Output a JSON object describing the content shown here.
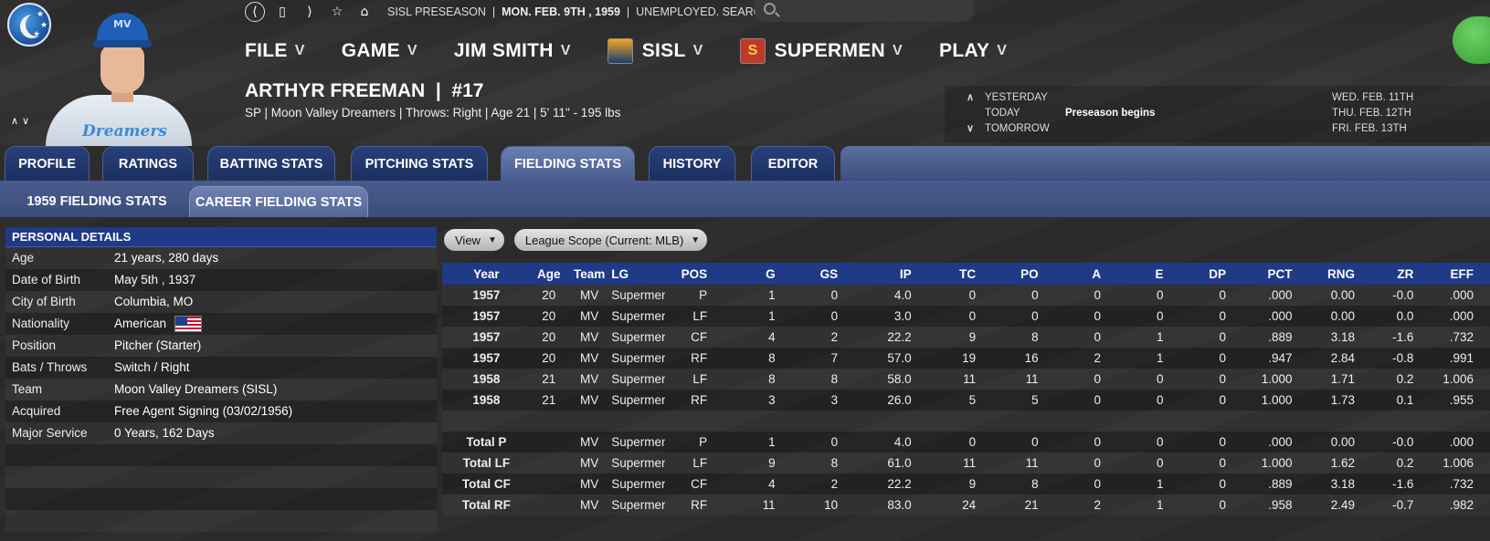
{
  "status_bar": {
    "season": "SISL PRESEASON",
    "date": "MON. FEB. 9TH , 1959",
    "job": "UNEMPLOYED. SEARCH JOBS..."
  },
  "search": {
    "placeholder": ""
  },
  "menu": [
    {
      "label": "FILE",
      "icon": null
    },
    {
      "label": "GAME",
      "icon": null
    },
    {
      "label": "JIM SMITH",
      "icon": null
    },
    {
      "label": "SISL",
      "icon": "sisl-league-logo"
    },
    {
      "label": "SUPERMEN",
      "icon": "supermen-team-logo"
    },
    {
      "label": "PLAY",
      "icon": null
    }
  ],
  "player": {
    "name": "ARTHYR FREEMAN",
    "number": "#17",
    "subtitle": "SP | Moon Valley Dreamers  |  Throws: Right  |  Age 21  |  5' 11\" - 195 lbs",
    "jersey_text": "Dreamers",
    "cap_text": "MV"
  },
  "calendar": {
    "rows": [
      {
        "arrow": "∧",
        "label": "YESTERDAY",
        "event": "",
        "date": "WED. FEB. 11TH"
      },
      {
        "arrow": "",
        "label": "TODAY",
        "event": "Preseason begins",
        "date": "THU. FEB. 12TH"
      },
      {
        "arrow": "∨",
        "label": "TOMORROW",
        "event": "",
        "date": "FRI. FEB. 13TH"
      }
    ]
  },
  "tabs": [
    {
      "label": "PROFILE",
      "active": false
    },
    {
      "label": "RATINGS",
      "active": false
    },
    {
      "label": "BATTING STATS",
      "active": false
    },
    {
      "label": "PITCHING STATS",
      "active": false
    },
    {
      "label": "FIELDING STATS",
      "active": true
    },
    {
      "label": "HISTORY",
      "active": false
    },
    {
      "label": "EDITOR",
      "active": false
    }
  ],
  "subtabs": [
    {
      "label": "1959 FIELDING STATS",
      "active": false
    },
    {
      "label": "CAREER FIELDING STATS",
      "active": true
    }
  ],
  "personal_details": {
    "header": "PERSONAL DETAILS",
    "rows": [
      {
        "key": "Age",
        "value": "21 years, 280 days"
      },
      {
        "key": "Date of Birth",
        "value": "May 5th , 1937"
      },
      {
        "key": "City of Birth",
        "value": "Columbia, MO"
      },
      {
        "key": "Nationality",
        "value": "American"
      },
      {
        "key": "Position",
        "value": "Pitcher (Starter)"
      },
      {
        "key": "Bats / Throws",
        "value": "Switch / Right"
      },
      {
        "key": "Team",
        "value": "Moon Valley Dreamers (SISL)"
      },
      {
        "key": "Acquired",
        "value": "Free Agent Signing (03/02/1956)"
      },
      {
        "key": "Major Service",
        "value": "0 Years, 162 Days"
      },
      {
        "key": "",
        "value": ""
      },
      {
        "key": "",
        "value": ""
      },
      {
        "key": "",
        "value": ""
      },
      {
        "key": "",
        "value": ""
      }
    ]
  },
  "controls": {
    "view": "View",
    "scope": "League Scope (Current: MLB)"
  },
  "table": {
    "columns": [
      "Year",
      "Age",
      "Team",
      "LG",
      "POS",
      "G",
      "GS",
      "IP",
      "TC",
      "PO",
      "A",
      "E",
      "DP",
      "PCT",
      "RNG",
      "ZR",
      "EFF"
    ],
    "rows": [
      [
        "1957",
        "20",
        "MV",
        "Supermen",
        "P",
        "1",
        "0",
        "4.0",
        "0",
        "0",
        "0",
        "0",
        "0",
        ".000",
        "0.00",
        "-0.0",
        ".000"
      ],
      [
        "1957",
        "20",
        "MV",
        "Supermen",
        "LF",
        "1",
        "0",
        "3.0",
        "0",
        "0",
        "0",
        "0",
        "0",
        ".000",
        "0.00",
        "0.0",
        ".000"
      ],
      [
        "1957",
        "20",
        "MV",
        "Supermen",
        "CF",
        "4",
        "2",
        "22.2",
        "9",
        "8",
        "0",
        "1",
        "0",
        ".889",
        "3.18",
        "-1.6",
        ".732"
      ],
      [
        "1957",
        "20",
        "MV",
        "Supermen",
        "RF",
        "8",
        "7",
        "57.0",
        "19",
        "16",
        "2",
        "1",
        "0",
        ".947",
        "2.84",
        "-0.8",
        ".991"
      ],
      [
        "1958",
        "21",
        "MV",
        "Supermen",
        "LF",
        "8",
        "8",
        "58.0",
        "11",
        "11",
        "0",
        "0",
        "0",
        "1.000",
        "1.71",
        "0.2",
        "1.006"
      ],
      [
        "1958",
        "21",
        "MV",
        "Supermen",
        "RF",
        "3",
        "3",
        "26.0",
        "5",
        "5",
        "0",
        "0",
        "0",
        "1.000",
        "1.73",
        "0.1",
        ".955"
      ],
      [
        "",
        "",
        "",
        "",
        "",
        "",
        "",
        "",
        "",
        "",
        "",
        "",
        "",
        "",
        "",
        "",
        ""
      ],
      [
        "Total P",
        "",
        "MV",
        "Supermen",
        "P",
        "1",
        "0",
        "4.0",
        "0",
        "0",
        "0",
        "0",
        "0",
        ".000",
        "0.00",
        "-0.0",
        ".000"
      ],
      [
        "Total LF",
        "",
        "MV",
        "Supermen",
        "LF",
        "9",
        "8",
        "61.0",
        "11",
        "11",
        "0",
        "0",
        "0",
        "1.000",
        "1.62",
        "0.2",
        "1.006"
      ],
      [
        "Total CF",
        "",
        "MV",
        "Supermen",
        "CF",
        "4",
        "2",
        "22.2",
        "9",
        "8",
        "0",
        "1",
        "0",
        ".889",
        "3.18",
        "-1.6",
        ".732"
      ],
      [
        "Total RF",
        "",
        "MV",
        "Supermen",
        "RF",
        "11",
        "10",
        "83.0",
        "24",
        "21",
        "2",
        "1",
        "0",
        ".958",
        "2.49",
        "-0.7",
        ".982"
      ]
    ]
  }
}
